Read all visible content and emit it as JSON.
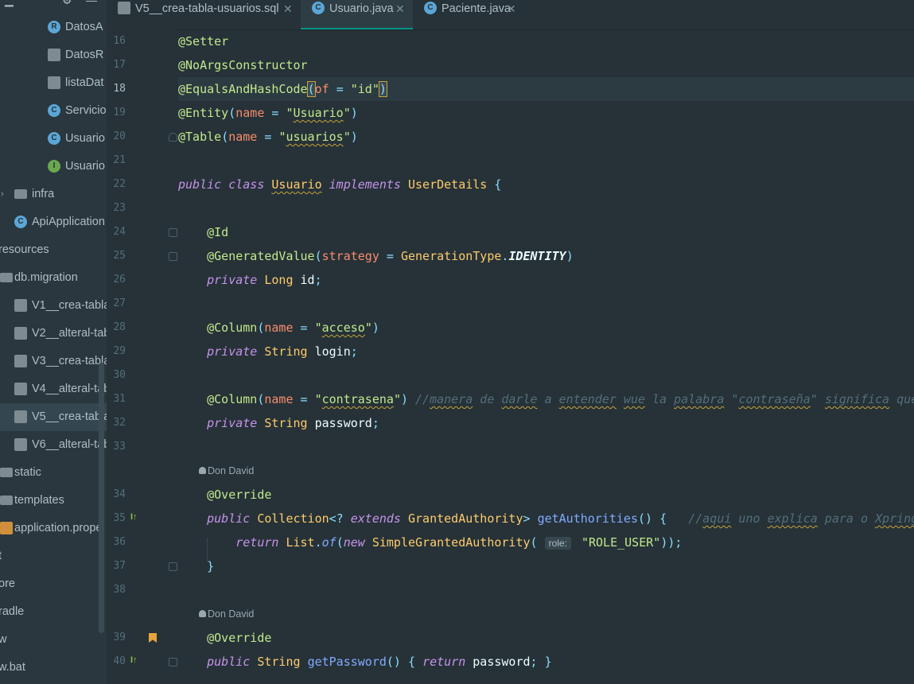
{
  "tree": {
    "items": [
      {
        "label": "DatosA",
        "icon": "class-r-icon",
        "indent": 2
      },
      {
        "label": "DatosR",
        "icon": "record-file-icon",
        "indent": 2
      },
      {
        "label": "listaDat",
        "icon": "record-file-icon",
        "indent": 2
      },
      {
        "label": "Servicio",
        "icon": "class-c-icon",
        "indent": 2
      },
      {
        "label": "Usuario",
        "icon": "class-c-icon",
        "indent": 2
      },
      {
        "label": "Usuario",
        "icon": "interface-i-icon",
        "indent": 2
      },
      {
        "label": "infra",
        "icon": "folder-icon",
        "indent": 1,
        "arrow": "›"
      },
      {
        "label": "ApiApplication",
        "icon": "spring-app-icon",
        "indent": 1
      },
      {
        "label": "resources",
        "icon": "",
        "indent": 0
      },
      {
        "label": "db.migration",
        "icon": "folder-icon",
        "indent": 0
      },
      {
        "label": "V1__crea-tabla",
        "icon": "sql-file-icon",
        "indent": 1
      },
      {
        "label": "V2__alteral-tab",
        "icon": "sql-file-icon",
        "indent": 1
      },
      {
        "label": "V3__crea-tabla",
        "icon": "sql-file-icon",
        "indent": 1
      },
      {
        "label": "V4__alteral-tab",
        "icon": "sql-file-icon",
        "indent": 1
      },
      {
        "label": "V5__crea-tabla",
        "icon": "sql-file-icon",
        "indent": 1,
        "selected": true
      },
      {
        "label": "V6__alteral-tab",
        "icon": "sql-file-icon",
        "indent": 1
      },
      {
        "label": "static",
        "icon": "folder-icon",
        "indent": 0
      },
      {
        "label": "templates",
        "icon": "folder-icon",
        "indent": 0
      },
      {
        "label": "application.prope",
        "icon": "properties-file-icon",
        "indent": 0
      },
      {
        "label": "t",
        "icon": "",
        "indent": -1
      },
      {
        "label": "ore",
        "icon": "",
        "indent": -1
      },
      {
        "label": "radle",
        "icon": "",
        "indent": -1
      },
      {
        "label": "w",
        "icon": "",
        "indent": -1
      },
      {
        "label": "w.bat",
        "icon": "",
        "indent": -1
      }
    ]
  },
  "tabs": [
    {
      "label": "V5__crea-tabla-usuarios.sql",
      "icon": "sql-file-icon",
      "active": false
    },
    {
      "label": "Usuario.java",
      "icon": "class-c-icon",
      "active": true
    },
    {
      "label": "Paciente.java",
      "icon": "class-c-icon",
      "active": false
    }
  ],
  "tab_close": "✕",
  "current_line": 18,
  "author_hint": "Don David",
  "inlay_role": "role:",
  "lines": [
    {
      "n": 16,
      "t": "@Setter"
    },
    {
      "n": 17,
      "t": "@NoArgsConstructor"
    },
    {
      "n": 18,
      "t": "@EqualsAndHashCode(of = \"id\")"
    },
    {
      "n": 19,
      "t": "@Entity(name = \"Usuario\")"
    },
    {
      "n": 20,
      "t": "@Table(name = \"usuarios\")"
    },
    {
      "n": 21,
      "t": ""
    },
    {
      "n": 22,
      "t": "public class Usuario implements UserDetails {"
    },
    {
      "n": 23,
      "t": ""
    },
    {
      "n": 24,
      "t": "    @Id"
    },
    {
      "n": 25,
      "t": "    @GeneratedValue(strategy = GenerationType.IDENTITY)"
    },
    {
      "n": 26,
      "t": "    private Long id;"
    },
    {
      "n": 27,
      "t": ""
    },
    {
      "n": 28,
      "t": "    @Column(name = \"acceso\")"
    },
    {
      "n": 29,
      "t": "    private String login;"
    },
    {
      "n": 30,
      "t": ""
    },
    {
      "n": 31,
      "t": "    @Column(name = \"contrasena\") //manera de darle a entender wue la palabra \"contraseña\" significa que"
    },
    {
      "n": 32,
      "t": "    private String password;"
    },
    {
      "n": 33,
      "t": ""
    },
    {
      "n": 34,
      "t": "    @Override"
    },
    {
      "n": 35,
      "t": "    public Collection<? extends GrantedAuthority> getAuthorities() {   //aqui uno explica para o Xpring"
    },
    {
      "n": 36,
      "t": "        return List.of(new SimpleGrantedAuthority( role: \"ROLE_USER\"));"
    },
    {
      "n": 37,
      "t": "    }"
    },
    {
      "n": 38,
      "t": ""
    },
    {
      "n": 39,
      "t": "    @Override"
    },
    {
      "n": 40,
      "t": "    public String getPassword() { return password; }"
    }
  ]
}
